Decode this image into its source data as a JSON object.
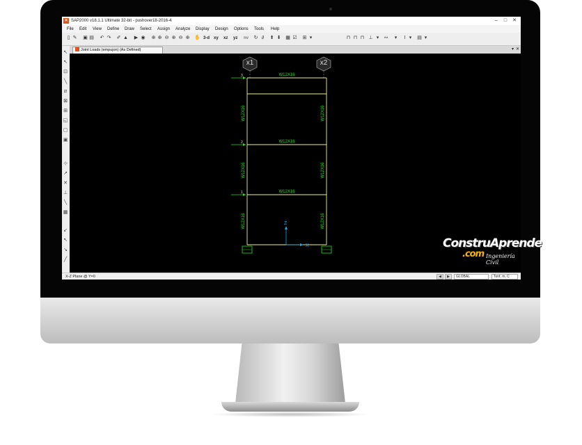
{
  "window": {
    "title": "SAP2000 v18.1.1 Ultimate 32-bit - pushover18-2016-4",
    "app_icon": "sap2000-logo-icon"
  },
  "menu": [
    "File",
    "Edit",
    "View",
    "Define",
    "Draw",
    "Select",
    "Assign",
    "Analyze",
    "Display",
    "Design",
    "Options",
    "Tools",
    "Help"
  ],
  "toolbar": {
    "view_buttons": [
      "3-d",
      "xy",
      "xz",
      "yz",
      "nv"
    ]
  },
  "tab": {
    "label": "Joint Loads (empujon) (As Defined)"
  },
  "model": {
    "grid_labels": [
      "x1",
      "x2"
    ],
    "beams": [
      {
        "label": "W12X16",
        "load_marker": "3"
      },
      {
        "label": "W12X16",
        "load_marker": "2"
      },
      {
        "label": "W12X16",
        "load_marker": "1"
      }
    ],
    "column_labels": [
      "W12X16",
      "W12X16",
      "W12X16",
      "W12X16",
      "W12X16",
      "W12X16"
    ],
    "axes": {
      "vertical": "Z",
      "horizontal": "X"
    }
  },
  "status": {
    "plane": "X-Z Plane @ Y=0",
    "coordinate_system": "GLOBAL",
    "units": "Tonf, m, C"
  },
  "watermark": {
    "main": "ConstruAprende",
    "sub": ".com",
    "tagline": "Ingeniería Civil"
  },
  "colors": {
    "frame": "#f0f08a",
    "labels": "#1fe01f",
    "axes": "#1aa7e0",
    "canvas": "#000000"
  }
}
